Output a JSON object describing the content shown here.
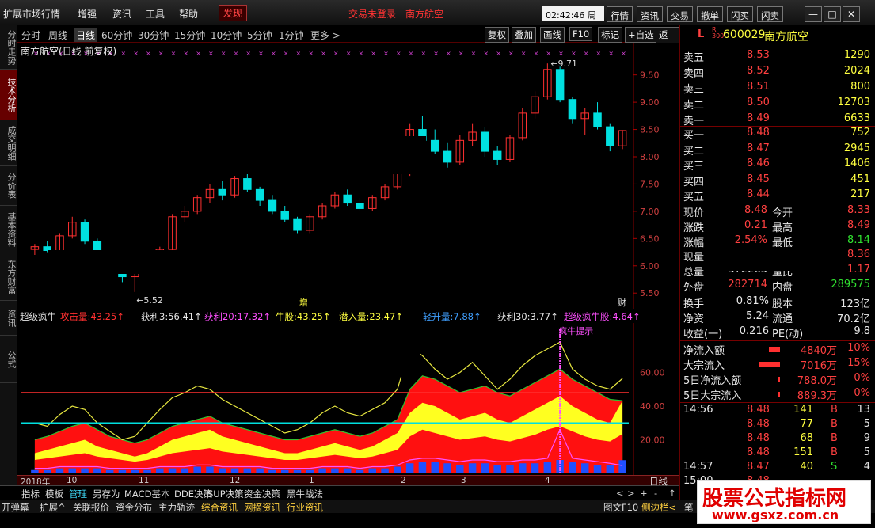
{
  "menu": {
    "items": [
      "扩展市场行情",
      "增强",
      "资讯",
      "工具",
      "帮助"
    ],
    "discover": "发现",
    "alerts": [
      "交易未登录",
      "南方航空"
    ],
    "clock": "02:42:46 周五",
    "quick_buttons": [
      "行情",
      "资讯",
      "交易",
      "撤单",
      "闪买",
      "闪卖"
    ],
    "win_buttons": [
      "—",
      "□",
      "✕"
    ]
  },
  "left_tabs": [
    "分时走势",
    "技术分析",
    "成交明细",
    "分价表",
    "基本资料",
    "东方财富",
    "资讯",
    "公式"
  ],
  "period_bar": {
    "periods": [
      "分时",
      "周线",
      "日线",
      "60分钟",
      "30分钟",
      "15分钟",
      "10分钟",
      "5分钟",
      "1分钟",
      "更多 >"
    ],
    "selected": "日线",
    "tools": [
      "复权",
      "叠加",
      "画线",
      "F10",
      "标记",
      "+自选",
      "返回"
    ]
  },
  "chart": {
    "title": "南方航空(日线 前复权)",
    "high_label": "9.71",
    "low_label": "5.52",
    "mark_zeng": "增",
    "mark_cai": "财",
    "y_ticks": [
      "9.50",
      "9.00",
      "8.50",
      "8.00",
      "7.50",
      "7.00",
      "6.50",
      "6.00",
      "5.50"
    ]
  },
  "indicator": {
    "name": "超级疯牛",
    "fields": [
      {
        "label": "攻击量:",
        "value": "43.25",
        "color": "#ff3030"
      },
      {
        "label": "获利3:",
        "value": "56.41",
        "color": "#e8e8e8"
      },
      {
        "label": "获利20:",
        "value": "17.32",
        "color": "#ff50ff"
      },
      {
        "label": "牛股:",
        "value": "43.25",
        "color": "#ffff40"
      },
      {
        "label": "潜入量:",
        "value": "23.47",
        "color": "#ffff40"
      },
      {
        "label": "轻升量:",
        "value": "7.88",
        "color": "#40a0ff"
      },
      {
        "label": "获利30:",
        "value": "3.77",
        "color": "#e8e8e8"
      },
      {
        "label": "超级疯牛股:",
        "value": "4.64",
        "color": "#ff50ff"
      }
    ],
    "signal_label": "疯牛提示",
    "y_ticks": [
      "60.00",
      "40.00",
      "20.00"
    ]
  },
  "time_axis": [
    "2018年",
    "10",
    "11",
    "12",
    "1",
    "2",
    "3",
    "4"
  ],
  "bottom_tabs": [
    "指标",
    "模板",
    "管理",
    "另存为",
    "MACD基本",
    "DDE决策",
    "SUP决策",
    "资金决策",
    "黑牛战法"
  ],
  "bottom_tabs_selected": "管理",
  "bottom_right": {
    "label": "日线",
    "nav": [
      "<",
      ">",
      "+",
      "-",
      "↑"
    ]
  },
  "status_bar": [
    "开弹幕",
    "扩展^",
    "关联报价",
    "资金分布",
    "主力轨迹",
    "综合资讯",
    "网摘资讯",
    "行业资讯"
  ],
  "status_right": [
    "图文F10",
    "侧边栏<",
    "笔"
  ],
  "quote": {
    "flag": "L",
    "flag_sub": "R 300",
    "code": "600029",
    "name": "南方航空",
    "sell": [
      {
        "label": "卖五",
        "price": "8.53",
        "vol": "1290"
      },
      {
        "label": "卖四",
        "price": "8.52",
        "vol": "2024"
      },
      {
        "label": "卖三",
        "price": "8.51",
        "vol": "800"
      },
      {
        "label": "卖二",
        "price": "8.50",
        "vol": "12703"
      },
      {
        "label": "卖一",
        "price": "8.49",
        "vol": "6633"
      }
    ],
    "buy": [
      {
        "label": "买一",
        "price": "8.48",
        "vol": "752"
      },
      {
        "label": "买二",
        "price": "8.47",
        "vol": "2945"
      },
      {
        "label": "买三",
        "price": "8.46",
        "vol": "1406"
      },
      {
        "label": "买四",
        "price": "8.45",
        "vol": "451"
      },
      {
        "label": "买五",
        "price": "8.44",
        "vol": "217"
      }
    ],
    "stats": [
      {
        "l1": "现价",
        "v1": "8.48",
        "c1": "red",
        "l2": "今开",
        "v2": "8.33",
        "c2": "red"
      },
      {
        "l1": "涨跌",
        "v1": "0.21",
        "c1": "red",
        "l2": "最高",
        "v2": "8.49",
        "c2": "red"
      },
      {
        "l1": "涨幅",
        "v1": "2.54%",
        "c1": "red",
        "l2": "最低",
        "v2": "8.14",
        "c2": "grn"
      },
      {
        "l1": "现量",
        "v1": "",
        "c1": "wht",
        "l2": "",
        "v2": "8.36",
        "c2": "red"
      },
      {
        "l1": "总量",
        "v1": "372263",
        "c1": "wht",
        "l2": "量比",
        "v2": "1.17",
        "c2": "red"
      },
      {
        "l1": "外盘",
        "v1": "282714",
        "c1": "red",
        "l2": "内盘",
        "v2": "289575",
        "c2": "grn"
      }
    ],
    "fundamentals": [
      {
        "l1": "换手",
        "v1": "0.81%",
        "l2": "股本",
        "v2": "123亿"
      },
      {
        "l1": "净资",
        "v1": "5.24",
        "l2": "流通",
        "v2": "70.2亿"
      },
      {
        "l1": "收益(一)",
        "v1": "0.216",
        "l2": "PE(动)",
        "v2": "9.8"
      }
    ],
    "flows": [
      {
        "label": "净流入额",
        "value": "4840万",
        "pct": "10%"
      },
      {
        "label": "大宗流入",
        "value": "7016万",
        "pct": "15%"
      },
      {
        "label": "5日净流入额",
        "value": "788.0万",
        "pct": "0%"
      },
      {
        "label": "5日大宗流入",
        "value": "889.3万",
        "pct": "0%"
      }
    ],
    "ticks": [
      {
        "time": "14:56",
        "price": "8.48",
        "vol": "141",
        "side": "B",
        "n": "13"
      },
      {
        "time": "",
        "price": "8.48",
        "vol": "77",
        "side": "B",
        "n": "5"
      },
      {
        "time": "",
        "price": "8.48",
        "vol": "68",
        "side": "B",
        "n": "9"
      },
      {
        "time": "",
        "price": "8.48",
        "vol": "151",
        "side": "B",
        "n": "5"
      },
      {
        "time": "14:57",
        "price": "8.47",
        "vol": "40",
        "side": "S",
        "n": "4"
      },
      {
        "time": "15:00",
        "price": "8.48",
        "vol": "",
        "side": "",
        "n": ""
      }
    ]
  },
  "watermark": {
    "title": "股票公式指标网",
    "url": "www.gsxz.com.cn"
  },
  "colors": {
    "up": "#ff3030",
    "down": "#00e0e0",
    "accent": "#ff4040",
    "fill_red": "#ff1010",
    "fill_yellow": "#ffff20",
    "fill_blue": "#2050ff"
  },
  "chart_data": {
    "type": "candlestick",
    "title": "南方航空(日线 前复权)",
    "ylim": [
      5.3,
      9.8
    ],
    "x": [
      "2018-09",
      "2018-10",
      "2018-11",
      "2018-12",
      "2019-01",
      "2019-02",
      "2019-03",
      "2019-04"
    ],
    "ohlc": [
      [
        6.3,
        6.4,
        6.2,
        6.35
      ],
      [
        6.35,
        6.45,
        6.25,
        6.28
      ],
      [
        6.28,
        6.6,
        6.25,
        6.55
      ],
      [
        6.55,
        6.9,
        6.5,
        6.8
      ],
      [
        6.8,
        6.85,
        6.4,
        6.45
      ],
      [
        6.45,
        6.5,
        6.1,
        6.15
      ],
      [
        6.15,
        6.2,
        5.9,
        5.95
      ],
      [
        5.95,
        6.05,
        5.7,
        5.8
      ],
      [
        5.8,
        6.1,
        5.52,
        6.0
      ],
      [
        6.0,
        6.2,
        5.95,
        6.1
      ],
      [
        6.1,
        6.35,
        6.05,
        6.3
      ],
      [
        6.3,
        6.95,
        6.25,
        6.9
      ],
      [
        6.9,
        7.1,
        6.8,
        7.0
      ],
      [
        7.0,
        7.3,
        6.95,
        7.25
      ],
      [
        7.25,
        7.5,
        7.15,
        7.4
      ],
      [
        7.4,
        7.55,
        7.2,
        7.3
      ],
      [
        7.3,
        7.65,
        7.25,
        7.6
      ],
      [
        7.6,
        7.7,
        7.35,
        7.4
      ],
      [
        7.4,
        7.45,
        7.1,
        7.2
      ],
      [
        7.2,
        7.3,
        6.95,
        7.0
      ],
      [
        7.0,
        7.1,
        6.8,
        6.85
      ],
      [
        6.85,
        6.9,
        6.6,
        6.65
      ],
      [
        6.65,
        6.95,
        6.6,
        6.9
      ],
      [
        6.9,
        7.15,
        6.85,
        7.1
      ],
      [
        7.1,
        7.35,
        7.05,
        7.3
      ],
      [
        7.3,
        7.4,
        7.1,
        7.15
      ],
      [
        7.15,
        7.25,
        7.0,
        7.05
      ],
      [
        7.05,
        7.3,
        7.0,
        7.25
      ],
      [
        7.25,
        7.5,
        7.2,
        7.45
      ],
      [
        7.45,
        7.8,
        7.4,
        7.7
      ],
      [
        7.7,
        8.6,
        7.65,
        8.5
      ],
      [
        8.5,
        8.75,
        8.2,
        8.3
      ],
      [
        8.3,
        8.5,
        8.05,
        8.1
      ],
      [
        8.1,
        8.25,
        7.8,
        7.9
      ],
      [
        7.9,
        8.4,
        7.85,
        8.3
      ],
      [
        8.3,
        8.6,
        8.2,
        8.45
      ],
      [
        8.45,
        8.55,
        8.0,
        8.1
      ],
      [
        8.1,
        8.2,
        7.85,
        7.95
      ],
      [
        7.95,
        8.4,
        7.9,
        8.35
      ],
      [
        8.35,
        8.9,
        8.3,
        8.8
      ],
      [
        8.8,
        9.2,
        8.7,
        9.1
      ],
      [
        9.1,
        9.71,
        9.05,
        9.6
      ],
      [
        9.6,
        9.65,
        9.0,
        9.05
      ],
      [
        9.05,
        9.1,
        8.6,
        8.7
      ],
      [
        8.7,
        8.9,
        8.4,
        8.8
      ],
      [
        8.8,
        9.0,
        8.5,
        8.55
      ],
      [
        8.55,
        8.6,
        8.1,
        8.2
      ],
      [
        8.2,
        8.49,
        8.14,
        8.48
      ]
    ],
    "series": [
      {
        "name": "攻击量",
        "values": [
          20,
          22,
          25,
          28,
          30,
          26,
          22,
          20,
          18,
          20,
          24,
          28,
          30,
          32,
          34,
          30,
          28,
          26,
          24,
          22,
          20,
          20,
          22,
          24,
          26,
          24,
          22,
          24,
          28,
          32,
          50,
          58,
          56,
          52,
          48,
          50,
          52,
          48,
          46,
          50,
          54,
          58,
          62,
          56,
          52,
          48,
          44,
          43.25
        ]
      },
      {
        "name": "牛股",
        "values": [
          12,
          14,
          16,
          18,
          20,
          16,
          14,
          12,
          10,
          12,
          16,
          20,
          22,
          24,
          26,
          22,
          20,
          18,
          16,
          14,
          12,
          12,
          14,
          16,
          18,
          16,
          14,
          16,
          20,
          24,
          36,
          42,
          40,
          36,
          32,
          34,
          36,
          32,
          30,
          34,
          38,
          42,
          46,
          40,
          36,
          32,
          30,
          43.25
        ]
      },
      {
        "name": "潜入量",
        "values": [
          8,
          9,
          10,
          11,
          12,
          10,
          9,
          8,
          7,
          8,
          10,
          12,
          13,
          14,
          15,
          13,
          12,
          11,
          10,
          9,
          8,
          8,
          9,
          10,
          11,
          10,
          9,
          10,
          12,
          14,
          22,
          26,
          24,
          22,
          20,
          21,
          22,
          20,
          19,
          21,
          23,
          26,
          28,
          25,
          22,
          20,
          19,
          23.47
        ]
      },
      {
        "name": "轻升量",
        "values": [
          2,
          2,
          3,
          3,
          3,
          3,
          2,
          2,
          2,
          2,
          3,
          3,
          3,
          4,
          4,
          3,
          3,
          3,
          3,
          2,
          2,
          2,
          2,
          3,
          3,
          3,
          2,
          3,
          3,
          4,
          6,
          7,
          7,
          6,
          5,
          6,
          6,
          5,
          5,
          6,
          6,
          7,
          8,
          7,
          6,
          5,
          5,
          7.88
        ]
      },
      {
        "name": "获利3",
        "values": [
          30,
          28,
          35,
          40,
          38,
          30,
          25,
          20,
          22,
          30,
          38,
          45,
          48,
          52,
          50,
          44,
          40,
          36,
          32,
          28,
          24,
          26,
          30,
          36,
          40,
          36,
          34,
          38,
          42,
          50,
          75,
          70,
          62,
          56,
          60,
          66,
          58,
          50,
          56,
          64,
          70,
          74,
          78,
          62,
          56,
          52,
          50,
          56.41
        ]
      },
      {
        "name": "超级疯牛股",
        "values": [
          3,
          3,
          4,
          4,
          4,
          4,
          3,
          3,
          3,
          3,
          4,
          4,
          4,
          5,
          5,
          4,
          4,
          4,
          4,
          3,
          3,
          3,
          3,
          4,
          4,
          4,
          3,
          4,
          4,
          5,
          8,
          9,
          9,
          8,
          7,
          8,
          8,
          7,
          7,
          8,
          8,
          9,
          26,
          9,
          8,
          7,
          6,
          4.64
        ]
      }
    ],
    "hlines": [
      {
        "value": 48,
        "color": "#ff3030"
      },
      {
        "value": 30,
        "color": "#00e0e0"
      }
    ],
    "ind_ylim": [
      0,
      80
    ]
  }
}
